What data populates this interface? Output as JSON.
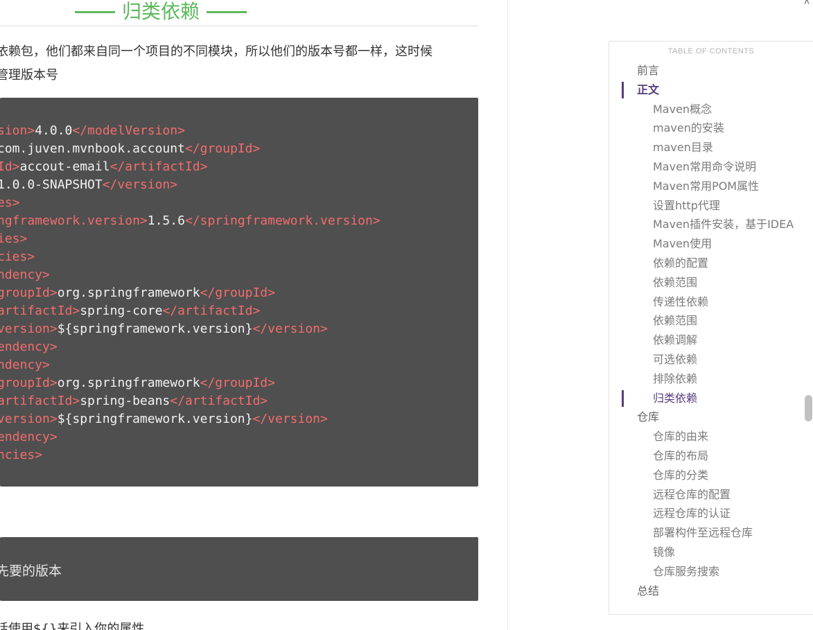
{
  "heading": "归类依赖",
  "paragraph": [
    "依赖包，他们都来自同一个项目的不同模块，所以他们的版本号都一样，这时候",
    "管理版本号"
  ],
  "code_lines": [
    [
      {
        "t": "tag",
        "v": "sion>"
      },
      {
        "t": "txt",
        "v": "4.0.0"
      },
      {
        "t": "tag",
        "v": "</modelVersion>"
      }
    ],
    [
      {
        "t": "txt",
        "v": "com.juven.mvnbook.account"
      },
      {
        "t": "tag",
        "v": "</groupId>"
      }
    ],
    [
      {
        "t": "tag",
        "v": "Id>"
      },
      {
        "t": "txt",
        "v": "accout-email"
      },
      {
        "t": "tag",
        "v": "</artifactId>"
      }
    ],
    [
      {
        "t": "txt",
        "v": "1.0.0-SNAPSHOT"
      },
      {
        "t": "tag",
        "v": "</version>"
      }
    ],
    [
      {
        "t": "tag",
        "v": "es>"
      }
    ],
    [
      {
        "t": "tag",
        "v": "ngframework.version>"
      },
      {
        "t": "txt",
        "v": "1.5.6"
      },
      {
        "t": "tag",
        "v": "</springframework.version>"
      }
    ],
    [
      {
        "t": "tag",
        "v": "ies>"
      }
    ],
    [
      {
        "t": "tag",
        "v": "cies>"
      }
    ],
    [
      {
        "t": "tag",
        "v": "ndency>"
      }
    ],
    [
      {
        "t": "tag",
        "v": "groupId>"
      },
      {
        "t": "txt",
        "v": "org.springframework"
      },
      {
        "t": "tag",
        "v": "</groupId>"
      }
    ],
    [
      {
        "t": "tag",
        "v": "artifactId>"
      },
      {
        "t": "txt",
        "v": "spring-core"
      },
      {
        "t": "tag",
        "v": "</artifactId>"
      }
    ],
    [
      {
        "t": "tag",
        "v": "version>"
      },
      {
        "t": "txt",
        "v": "${springframework.version}"
      },
      {
        "t": "tag",
        "v": "</version>"
      }
    ],
    [
      {
        "t": "tag",
        "v": "endency>"
      }
    ],
    [
      {
        "t": "tag",
        "v": "ndency>"
      }
    ],
    [
      {
        "t": "tag",
        "v": "groupId>"
      },
      {
        "t": "txt",
        "v": "org.springframework"
      },
      {
        "t": "tag",
        "v": "</groupId>"
      }
    ],
    [
      {
        "t": "tag",
        "v": "artifactId>"
      },
      {
        "t": "txt",
        "v": "spring-beans"
      },
      {
        "t": "tag",
        "v": "</artifactId>"
      }
    ],
    [
      {
        "t": "tag",
        "v": "version>"
      },
      {
        "t": "txt",
        "v": "${springframework.version}"
      },
      {
        "t": "tag",
        "v": "</version>"
      }
    ],
    [
      {
        "t": "tag",
        "v": "endency>"
      }
    ],
    [
      {
        "t": "tag",
        "v": "ncies>"
      }
    ]
  ],
  "code2_text": "先要的版本",
  "paragraph2": "话使用${}来引入你的属性",
  "toc": {
    "header": "TABLE OF CONTENTS",
    "items": [
      {
        "label": "前言",
        "level": 1
      },
      {
        "label": "正文",
        "level": 1,
        "state": "active-parent"
      },
      {
        "label": "Maven概念",
        "level": 2
      },
      {
        "label": "maven的安装",
        "level": 2
      },
      {
        "label": "maven目录",
        "level": 2
      },
      {
        "label": "Maven常用命令说明",
        "level": 2
      },
      {
        "label": "Maven常用POM属性",
        "level": 2
      },
      {
        "label": "设置http代理",
        "level": 2
      },
      {
        "label": "Maven插件安装，基于IDEA",
        "level": 2
      },
      {
        "label": "Maven使用",
        "level": 2
      },
      {
        "label": "依赖的配置",
        "level": 2
      },
      {
        "label": "依赖范围",
        "level": 2
      },
      {
        "label": "传递性依赖",
        "level": 2
      },
      {
        "label": "依赖范围",
        "level": 2
      },
      {
        "label": "依赖调解",
        "level": 2
      },
      {
        "label": "可选依赖",
        "level": 2
      },
      {
        "label": "排除依赖",
        "level": 2
      },
      {
        "label": "归类依赖",
        "level": 2,
        "state": "active"
      },
      {
        "label": "仓库",
        "level": 1
      },
      {
        "label": "仓库的由来",
        "level": 2
      },
      {
        "label": "仓库的布局",
        "level": 2
      },
      {
        "label": "仓库的分类",
        "level": 2
      },
      {
        "label": "远程仓库的配置",
        "level": 2
      },
      {
        "label": "远程仓库的认证",
        "level": 2
      },
      {
        "label": "部署构件至远程仓库",
        "level": 2
      },
      {
        "label": "镜像",
        "level": 2
      },
      {
        "label": "仓库服务搜索",
        "level": 2
      },
      {
        "label": "总结",
        "level": 1
      }
    ]
  },
  "colors": {
    "heading_green": "#5cb85c",
    "code_bg": "#4f4f4f",
    "code_tag": "#f36d6d",
    "toc_active": "#563d7c"
  },
  "icons": {
    "scroll_up": "chevron-up-icon"
  }
}
